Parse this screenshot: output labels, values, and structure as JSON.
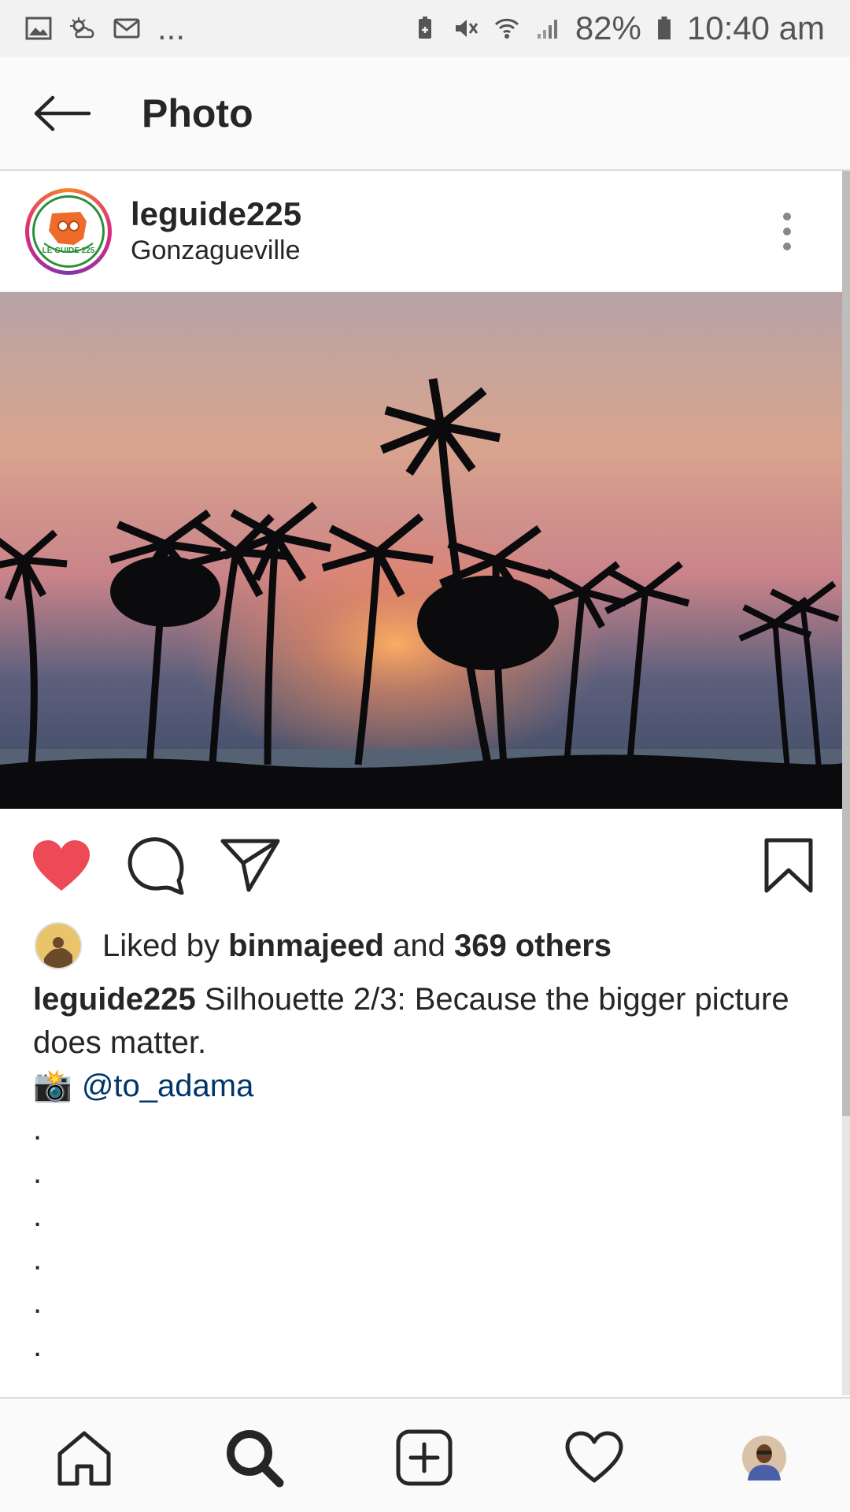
{
  "status_bar": {
    "left_icons": [
      "image-icon",
      "weather-icon",
      "mail-icon"
    ],
    "overflow": "...",
    "battery_percent": "82%",
    "time": "10:40 am"
  },
  "header": {
    "title": "Photo"
  },
  "post": {
    "username": "leguide225",
    "location": "Gonzagueville",
    "logo_text": "LE GUIDE 225",
    "likes": {
      "prefix": "Liked by",
      "liker": "binmajeed",
      "joiner": "and",
      "others": "369 others"
    },
    "caption": {
      "username": "leguide225",
      "text": "Silhouette 2/3: Because the bigger picture does matter.",
      "camera_emoji": "📸",
      "mention": "@to_adama",
      "dots": [
        ".",
        ".",
        ".",
        ".",
        ".",
        "."
      ]
    }
  },
  "colors": {
    "like_red": "#ed4956",
    "mention_blue": "#003569",
    "text": "#262626"
  },
  "bottom_nav": [
    "home-icon",
    "search-icon",
    "add-post-icon",
    "activity-heart-icon",
    "profile-avatar"
  ]
}
